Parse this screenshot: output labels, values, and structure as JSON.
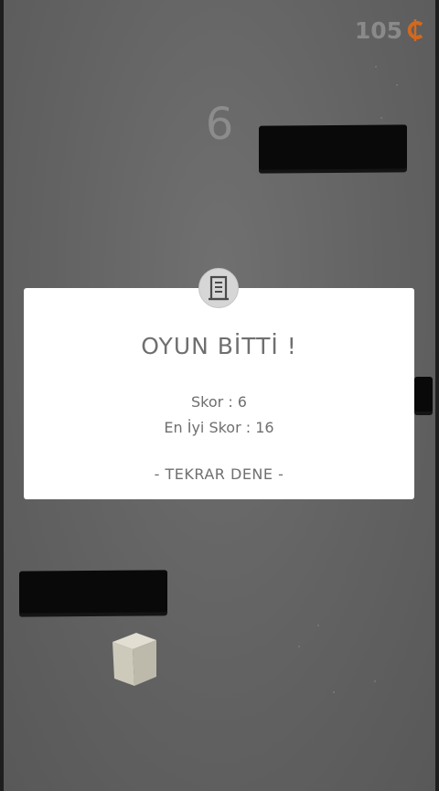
{
  "hud": {
    "coins": "105",
    "coin_symbol": "₵",
    "coin_color": "#d2691e",
    "score": "6"
  },
  "game_over": {
    "badge_icon": "leaderboard-icon",
    "title": "OYUN BİTTİ !",
    "score_line": "Skor : 6",
    "best_line": "En İyi Skor : 16",
    "retry_label": "- TEKRAR DENE -"
  },
  "colors": {
    "background": "#646464",
    "platform": "#090909",
    "panel": "#ffffff",
    "panel_text": "#6f6f6f",
    "cube": "#d3cfc2"
  }
}
